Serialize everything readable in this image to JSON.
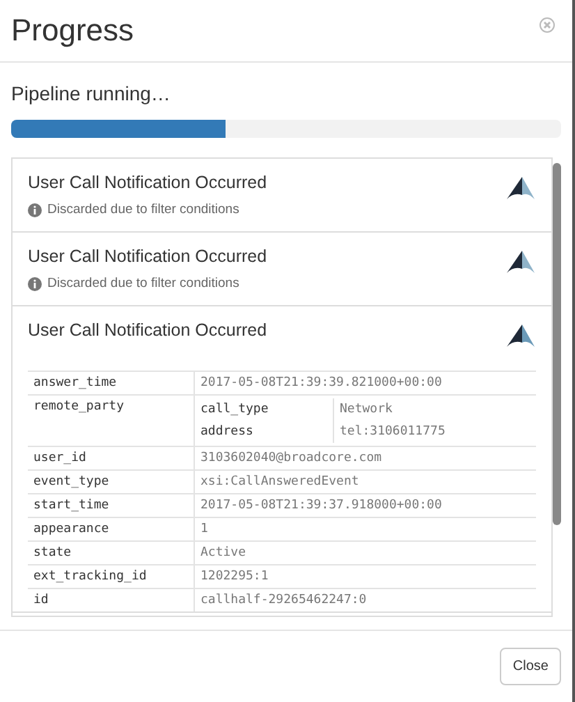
{
  "dialog": {
    "title": "Progress"
  },
  "status": "Pipeline running…",
  "progress": {
    "level": 0.39
  },
  "events": [
    {
      "title": "User Call Notification Occurred",
      "expanded": false,
      "note": "Discarded due to filter conditions"
    },
    {
      "title": "User Call Notification Occurred",
      "expanded": false,
      "note": "Discarded due to filter conditions"
    },
    {
      "title": "User Call Notification Occurred",
      "expanded": true,
      "fields": [
        {
          "kind": "text",
          "key": "answer_time",
          "value": "2017-05-08T21:39:39.821000+00:00"
        },
        {
          "kind": "nested",
          "key": "remote_party",
          "children": [
            {
              "key": "call_type",
              "value": "Network"
            },
            {
              "key": "address",
              "value": "tel:3106011775"
            }
          ]
        },
        {
          "kind": "text",
          "key": "user_id",
          "value": "3103602040@broadcore.com"
        },
        {
          "kind": "text",
          "key": "event_type",
          "value": "xsi:CallAnsweredEvent"
        },
        {
          "kind": "text",
          "key": "start_time",
          "value": "2017-05-08T21:39:37.918000+00:00"
        },
        {
          "kind": "text",
          "key": "appearance",
          "value": "1"
        },
        {
          "kind": "text",
          "key": "state",
          "value": "Active"
        },
        {
          "kind": "text",
          "key": "ext_tracking_id",
          "value": "1202295:1"
        },
        {
          "kind": "text",
          "key": "id",
          "value": "callhalf-29265462247:0"
        }
      ]
    }
  ],
  "footer": {
    "button": "Close"
  }
}
